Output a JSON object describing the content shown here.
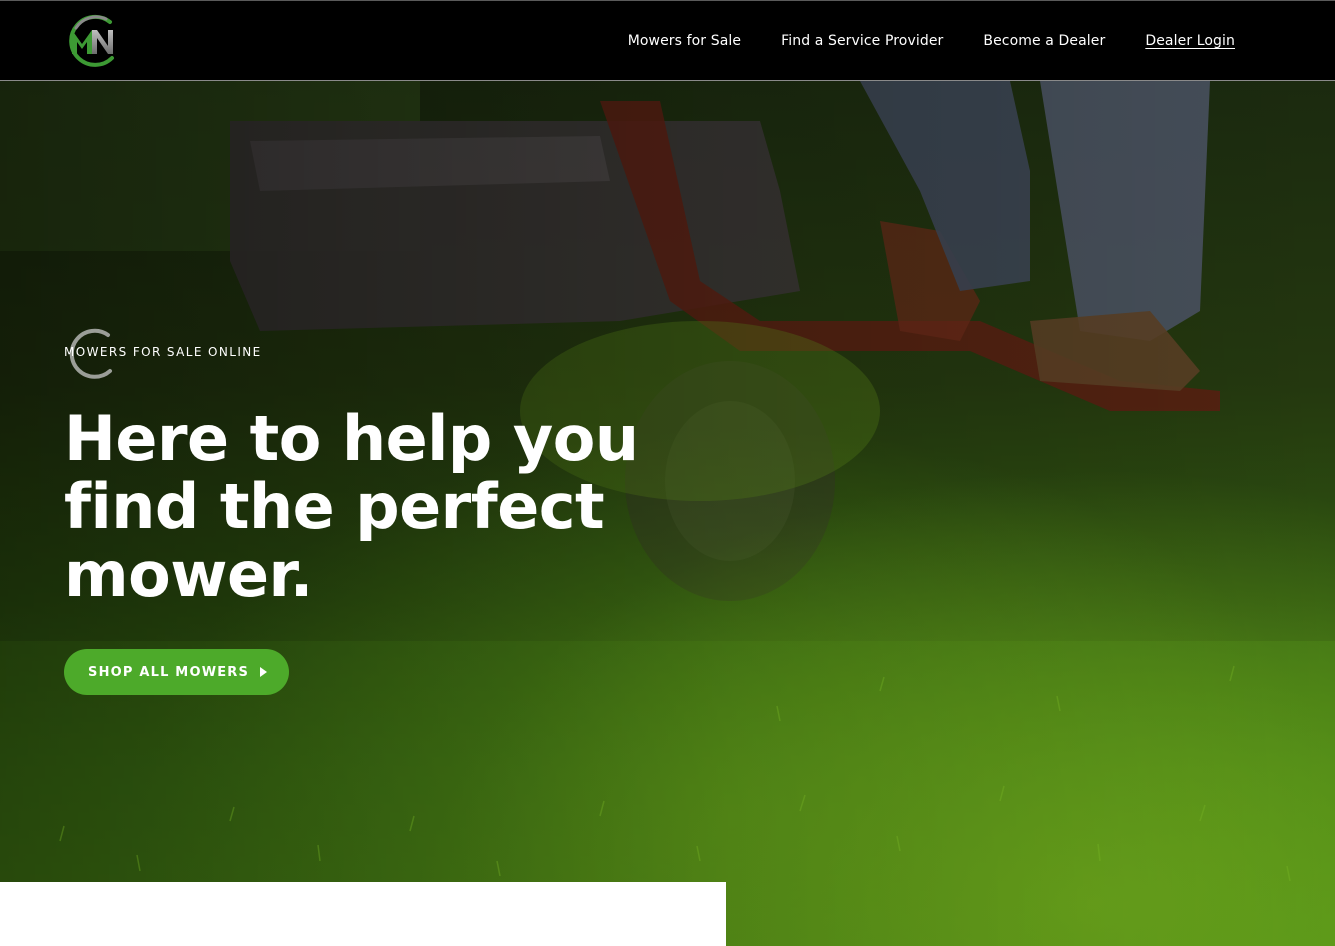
{
  "header": {
    "logo_text": "MN",
    "nav": [
      {
        "label": "Mowers for Sale"
      },
      {
        "label": "Find a Service Provider"
      },
      {
        "label": "Become a Dealer"
      },
      {
        "label": "Dealer Login"
      }
    ]
  },
  "hero": {
    "eyebrow": "MOWERS FOR SALE ONLINE",
    "headline": "Here to help you find the perfect mower.",
    "cta_label": "SHOP ALL MOWERS",
    "cta_icon": "caret-right-icon",
    "background_image": "lawn-mower-cutting-grass-photo"
  },
  "colors": {
    "header_bg": "#000000",
    "accent_green": "#4daa2a",
    "logo_green": "#3d9a34",
    "text_white": "#ffffff"
  }
}
